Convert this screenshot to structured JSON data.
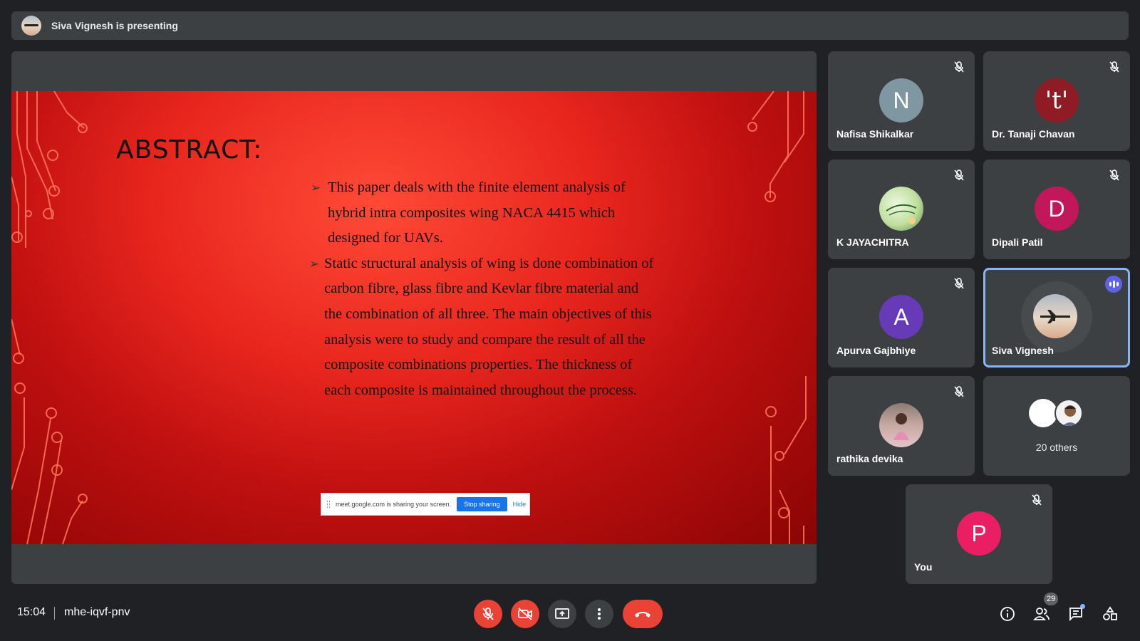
{
  "presenter_bar": {
    "text": "Siva Vignesh is presenting"
  },
  "slide": {
    "title": "ABSTRACT:",
    "bullets": [
      "This paper deals with the finite element analysis of hybrid intra composites wing NACA 4415 which designed for UAVs.",
      "Static structural analysis of wing is done combination of carbon fibre, glass fibre and Kevlar fibre material and the combination of all three. The main objectives of this analysis were to study and compare the result of all the composite combinations properties. The thickness of each composite is maintained throughout the process."
    ]
  },
  "share_bar": {
    "message": "meet.google.com is sharing your screen.",
    "stop_label": "Stop sharing",
    "hide_label": "Hide"
  },
  "participants": [
    {
      "name": "Nafisa Shikalkar",
      "initial": "N",
      "color": "#7e97a1",
      "muted": true
    },
    {
      "name": "Dr. Tanaji Chavan",
      "initial": "'t'",
      "color": "#8f1c24",
      "muted": true
    },
    {
      "name": "K JAYACHITRA",
      "initial": "",
      "color": "#cfe5b8",
      "muted": true
    },
    {
      "name": "Dipali Patil",
      "initial": "D",
      "color": "#c2185b",
      "muted": true
    },
    {
      "name": "Apurva Gajbhiye",
      "initial": "A",
      "color": "#673ab7",
      "muted": true
    },
    {
      "name": "Siva Vignesh",
      "initial": "",
      "color": "#d8c9b8",
      "muted": false,
      "speaking": true
    },
    {
      "name": "rathika devika",
      "initial": "",
      "color": "#c9a7a0",
      "muted": true
    },
    {
      "name": "You",
      "initial": "P",
      "color": "#e91e63",
      "muted": true
    }
  ],
  "others": {
    "label": "20 others"
  },
  "bottom_bar": {
    "time": "15:04",
    "meeting_code": "mhe-iqvf-pnv",
    "people_count": "29"
  },
  "colors": {
    "accent": "#8ab4f8",
    "danger": "#ea4335",
    "tile_bg": "#3c4043",
    "app_bg": "#202124"
  }
}
